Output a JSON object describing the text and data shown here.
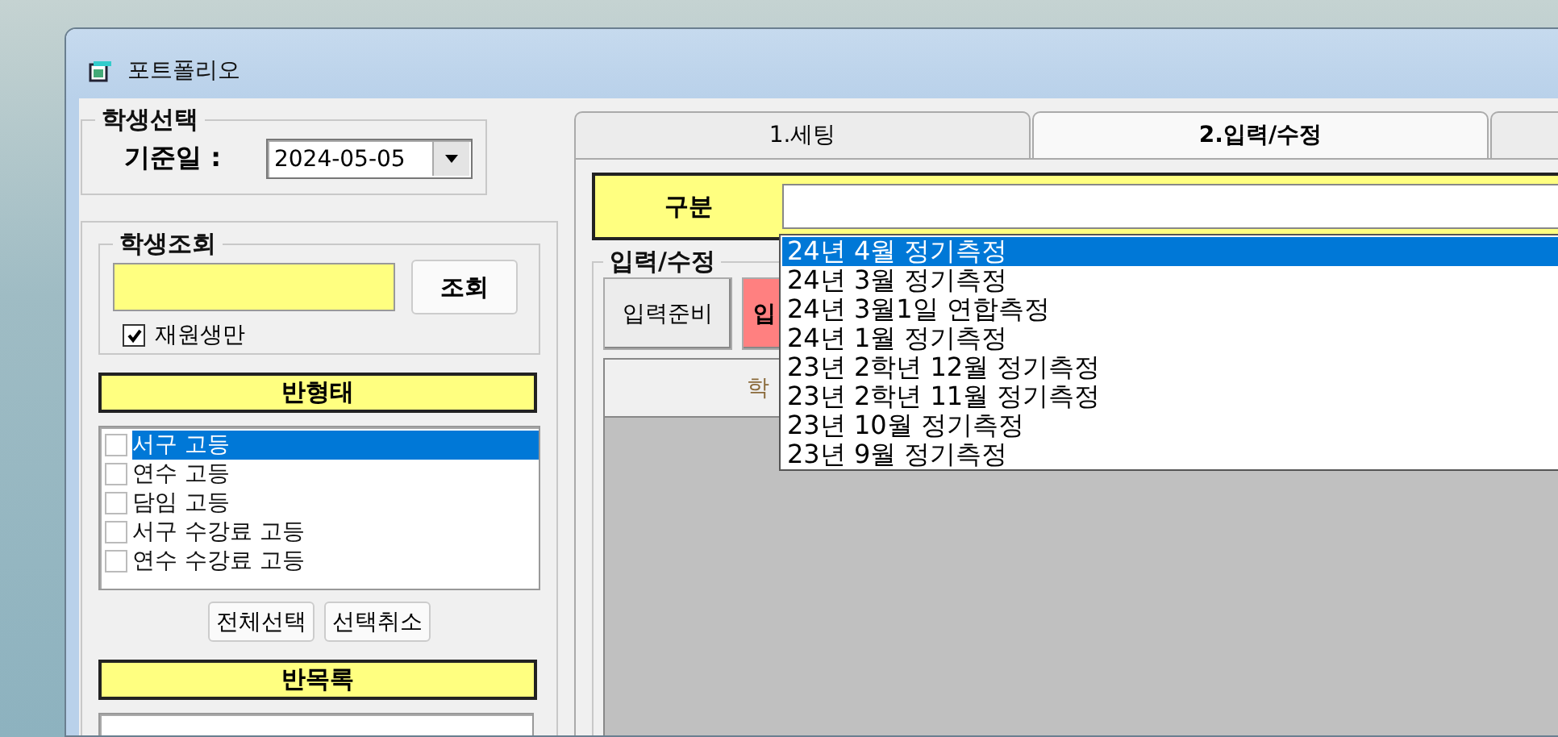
{
  "window": {
    "title": "포트폴리오"
  },
  "student_select": {
    "title": "학생선택",
    "date_label": "기준일 :",
    "date_value": "2024-05-05"
  },
  "student_search": {
    "title": "학생조회",
    "button": "조회",
    "active_only": {
      "label": "재원생만",
      "checked": true
    }
  },
  "class_type": {
    "header": "반형태",
    "items": [
      {
        "label": "서구 고등",
        "checked": false,
        "selected": true
      },
      {
        "label": "연수 고등",
        "checked": false,
        "selected": false
      },
      {
        "label": "담임 고등",
        "checked": false,
        "selected": false
      },
      {
        "label": "서구 수강료 고등",
        "checked": false,
        "selected": false
      },
      {
        "label": "연수 수강료 고등",
        "checked": false,
        "selected": false
      }
    ],
    "buttons": [
      "전체선택",
      "선택취소"
    ]
  },
  "class_list": {
    "header": "반목록"
  },
  "tabs": [
    {
      "label": "1.세팅",
      "selected": false
    },
    {
      "label": "2.입력/수정",
      "selected": true
    },
    {
      "selected": false
    }
  ],
  "category": {
    "label": "구분",
    "options": [
      {
        "label": "24년 4월 정기측정",
        "selected": true
      },
      {
        "label": "24년 3월 정기측정",
        "selected": false
      },
      {
        "label": "24년 3월1일 연합측정",
        "selected": false
      },
      {
        "label": "24년 1월 정기측정",
        "selected": false
      },
      {
        "label": "23년 2학년 12월 정기측정",
        "selected": false
      },
      {
        "label": "23년 2학년 11월 정기측정",
        "selected": false
      },
      {
        "label": "23년 10월 정기측정",
        "selected": false
      },
      {
        "label": "23년 9월 정기측정",
        "selected": false
      }
    ]
  },
  "edit_group": {
    "title": "입력/수정",
    "buttons": [
      {
        "label": "입력준비",
        "kind": "normal"
      },
      {
        "label": "입",
        "kind": "alert"
      }
    ]
  },
  "grid": {
    "columns": [
      "학"
    ]
  }
}
